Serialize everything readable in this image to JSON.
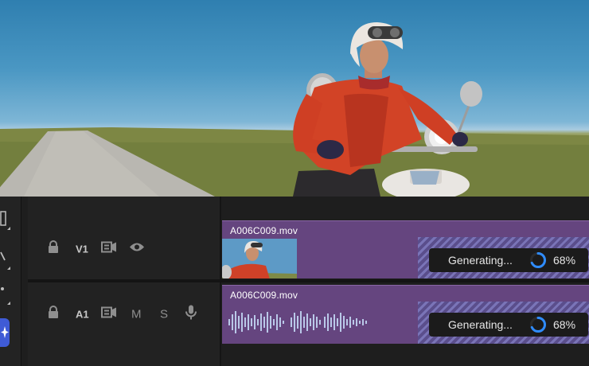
{
  "preview": {
    "description_icon": "video-preview"
  },
  "toolbar": {
    "tools": [
      "track-select-icon",
      "pen-icon",
      "razor-icon",
      "hand-icon"
    ],
    "ai_tool_icon": "sparkle-icon"
  },
  "tracks": [
    {
      "id": "V1",
      "label": "V1",
      "icons": [
        "lock-icon",
        "sync-lock-icon",
        "eye-icon"
      ],
      "clip": {
        "name": "A006C009.mov",
        "status_text": "Generating...",
        "progress_text": "68%",
        "progress": 0.68
      }
    },
    {
      "id": "A1",
      "label": "A1",
      "icons": [
        "lock-icon",
        "sync-lock-icon",
        "mute-icon",
        "solo-icon",
        "mic-icon"
      ],
      "mute_label": "M",
      "solo_label": "S",
      "clip": {
        "name": "A006C009.mov",
        "status_text": "Generating...",
        "progress_text": "68%",
        "progress": 0.68
      }
    }
  ],
  "colors": {
    "clip": "#65457f",
    "spinner": "#2f8cff",
    "ai_button": "#3f5bd6"
  }
}
